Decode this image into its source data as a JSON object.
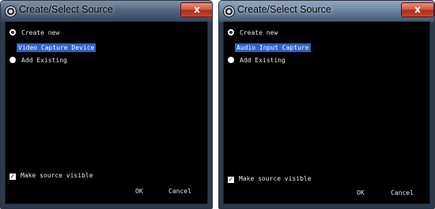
{
  "dialogs": [
    {
      "title": "Create/Select Source",
      "close_label": "x",
      "create_new_label": "Create new",
      "selected_source": "Video Capture Device",
      "add_existing_label": "Add Existing",
      "make_visible_label": "Make source visible",
      "ok_label": "OK",
      "cancel_label": "Cancel"
    },
    {
      "title": "Create/Select Source",
      "close_label": "x",
      "create_new_label": "Create new",
      "selected_source": "Audio Input Capture",
      "add_existing_label": "Add Existing",
      "make_visible_label": "Make source visible",
      "ok_label": "OK",
      "cancel_label": "Cancel"
    }
  ],
  "icons": {
    "app": "obs-icon",
    "close": "close-icon",
    "radio": "radio-icon",
    "checkbox": "checkmark-icon"
  },
  "colors": {
    "client_bg": "#000000",
    "selection": "#2f63c9",
    "close_button": "#c9472f"
  }
}
